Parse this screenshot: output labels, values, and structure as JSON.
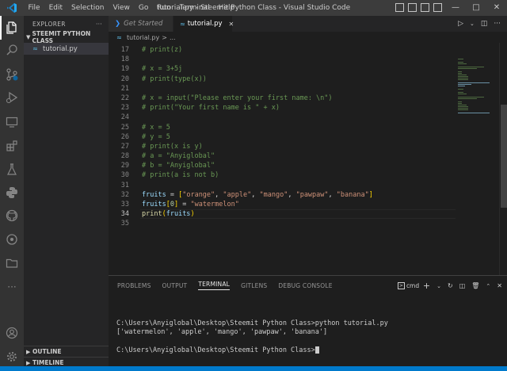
{
  "titlebar": {
    "menu": [
      "File",
      "Edit",
      "Selection",
      "View",
      "Go",
      "Run",
      "Terminal",
      "Help"
    ],
    "title": "tutorial.py - Steemit Python Class - Visual Studio Code"
  },
  "sidebar": {
    "header": "EXPLORER",
    "more": "···",
    "folder": "STEEMIT PYTHON CLASS",
    "files": [
      {
        "name": "tutorial.py"
      }
    ],
    "outline": "OUTLINE",
    "timeline": "TIMELINE"
  },
  "tabs": [
    {
      "label": "Get Started",
      "active": false
    },
    {
      "label": "tutorial.py",
      "active": true
    }
  ],
  "breadcrumb": {
    "file": "tutorial.py",
    "sep": ">"
  },
  "code": {
    "current_line": 34,
    "lines": [
      {
        "n": 17,
        "text": "# print(z)"
      },
      {
        "n": 18,
        "text": ""
      },
      {
        "n": 19,
        "text": "# x = 3+5j"
      },
      {
        "n": 20,
        "text": "# print(type(x))"
      },
      {
        "n": 21,
        "text": ""
      },
      {
        "n": 22,
        "text": "# x = input(\"Please enter your first name: \\n\")"
      },
      {
        "n": 23,
        "text": "# print(\"Your first name is \" + x)"
      },
      {
        "n": 24,
        "text": ""
      },
      {
        "n": 25,
        "text": "# x = 5"
      },
      {
        "n": 26,
        "text": "# y = 5"
      },
      {
        "n": 27,
        "text": "# print(x is y)"
      },
      {
        "n": 28,
        "text": "# a = \"Anyiglobal\""
      },
      {
        "n": 29,
        "text": "# b = \"Anyiglobal\""
      },
      {
        "n": 30,
        "text": "# print(a is not b)"
      },
      {
        "n": 31,
        "text": ""
      },
      {
        "n": 32,
        "text": "fruits = [\"orange\", \"apple\", \"mango\", \"pawpaw\", \"banana\"]"
      },
      {
        "n": 33,
        "text": "fruits[0] = \"watermelon\""
      },
      {
        "n": 34,
        "text": "print(fruits)"
      },
      {
        "n": 35,
        "text": ""
      }
    ]
  },
  "panel": {
    "tabs": [
      "PROBLEMS",
      "OUTPUT",
      "TERMINAL",
      "GITLENS",
      "DEBUG CONSOLE"
    ],
    "active_tab": "TERMINAL",
    "shell": "cmd",
    "terminal_lines": [
      "",
      "C:\\Users\\Anyiglobal\\Desktop\\Steemit Python Class>python tutorial.py",
      "['watermelon', 'apple', 'mango', 'pawpaw', 'banana']",
      "",
      "C:\\Users\\Anyiglobal\\Desktop\\Steemit Python Class>"
    ]
  },
  "colors": {
    "accent": "#007acc",
    "comment": "#6a9955",
    "string": "#ce9178",
    "variable": "#9cdcfe",
    "function": "#dcdcaa"
  }
}
